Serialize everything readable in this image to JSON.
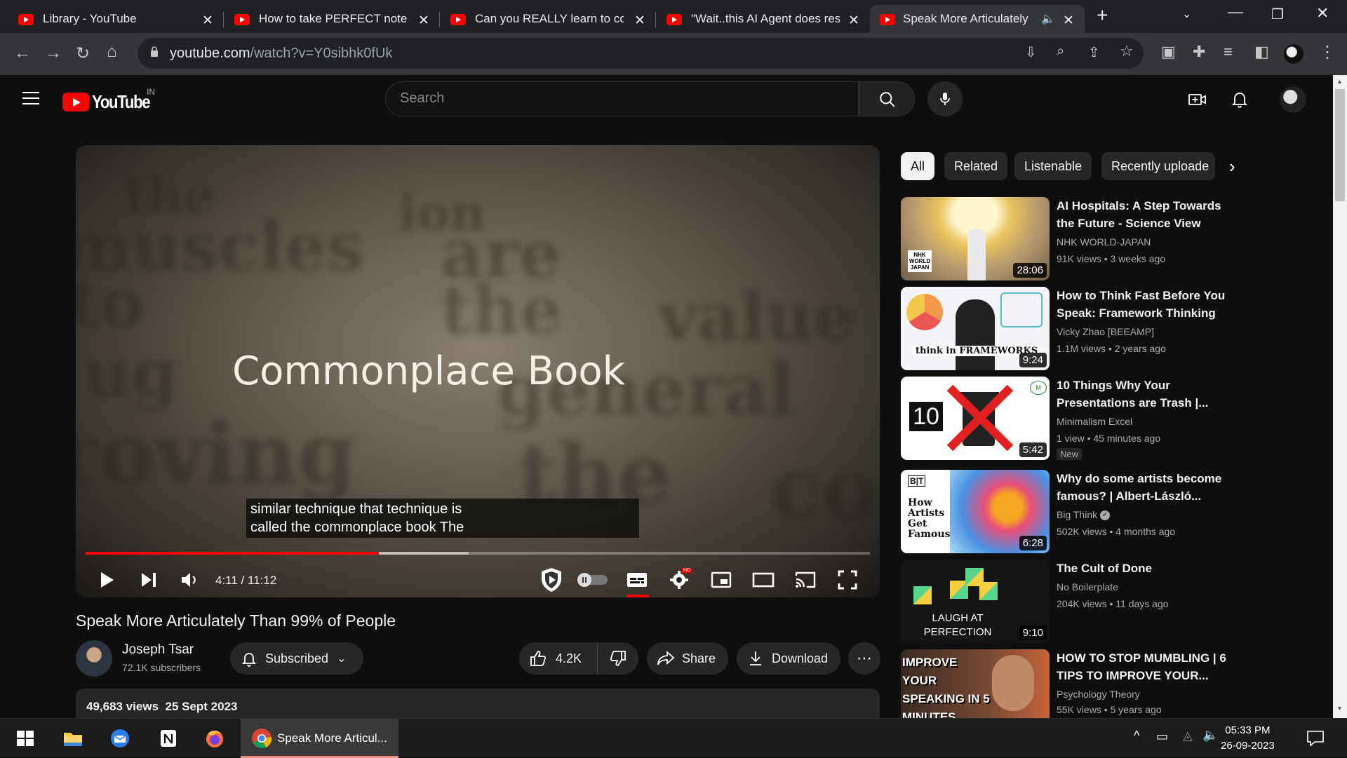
{
  "browser": {
    "tabs": [
      {
        "title": "Library - YouTube",
        "active": false
      },
      {
        "title": "How to take PERFECT notes w",
        "active": false
      },
      {
        "title": "Can you REALLY learn to code",
        "active": false
      },
      {
        "title": "\"Wait..this AI Agent does rese",
        "active": false
      },
      {
        "title": "Speak More Articulately T",
        "active": true
      }
    ],
    "new_tab_symbol": "+",
    "url_domain": "youtube.com",
    "url_path": "/watch?v=Y0sibhk0fUk"
  },
  "youtube": {
    "logo_text": "YouTube",
    "country_code": "IN",
    "search_placeholder": "Search"
  },
  "player": {
    "overlay_title": "Commonplace Book",
    "background_words": [
      "the",
      "muscles",
      "are",
      "toward",
      "ion",
      "to",
      "the",
      "value",
      "ug",
      "general",
      "roving",
      "the",
      "co"
    ],
    "caption_line1": "similar technique that technique is",
    "caption_line2": "called the commonplace book The",
    "current_time": "4:11",
    "duration": "11:12",
    "time_text": "4:11 / 11:12",
    "progress_fraction": 0.374,
    "buffered_fraction": 0.488,
    "settings_badge": "HD"
  },
  "video": {
    "title": "Speak More Articulately Than 99% of People",
    "channel_name": "Joseph Tsar",
    "subscribers": "72.1K subscribers",
    "subscribe_label": "Subscribed",
    "likes": "4.2K",
    "share_label": "Share",
    "download_label": "Download",
    "views": "49,683 views",
    "date": "25 Sept 2023"
  },
  "chips": [
    "All",
    "Related",
    "Listenable",
    "Recently uploade"
  ],
  "recommendations": [
    {
      "title": "AI Hospitals: A Step Towards the Future - Science View",
      "channel": "NHK WORLD-JAPAN",
      "views": "91K views",
      "age": "3 weeks ago",
      "duration": "28:06",
      "thumb_text": "NHK WORLD JAPAN"
    },
    {
      "title": "How to Think Fast Before You Speak: Framework Thinking",
      "channel": "Vicky Zhao [BEEAMP]",
      "views": "1.1M views",
      "age": "2 years ago",
      "duration": "9:24",
      "thumb_text": "think in FRAMEWORKS"
    },
    {
      "title": "10 Things Why Your Presentations are Trash |...",
      "channel": "Minimalism Excel",
      "views": "1 view",
      "age": "45 minutes ago",
      "duration": "5:42",
      "badge": "New",
      "thumb_text": "10"
    },
    {
      "title": "Why do some artists become famous? | Albert-László...",
      "channel": "Big Think",
      "views": "502K views",
      "age": "4 months ago",
      "duration": "6:28",
      "thumb_text": "How Artists Get Famous",
      "thumb_logo": "B|T"
    },
    {
      "title": "The Cult of Done",
      "channel": "No Boilerplate",
      "views": "204K views",
      "age": "11 days ago",
      "duration": "9:10",
      "thumb_text": "LAUGH AT PERFECTION"
    },
    {
      "title": "HOW TO STOP MUMBLING | 6 TIPS TO IMPROVE YOUR...",
      "channel": "Psychology Theory",
      "views": "55K views",
      "age": "5 years ago",
      "duration": "",
      "thumb_text": "IMPROVE YOUR SPEAKING IN 5 MINUTES"
    }
  ],
  "taskbar": {
    "active_app_label": "Speak More Articul...",
    "time": "05:33 PM",
    "date": "26-09-2023"
  },
  "colors": {
    "yt_red": "#ff0000",
    "bg": "#0f0f0f",
    "chip_bg": "#272727"
  }
}
